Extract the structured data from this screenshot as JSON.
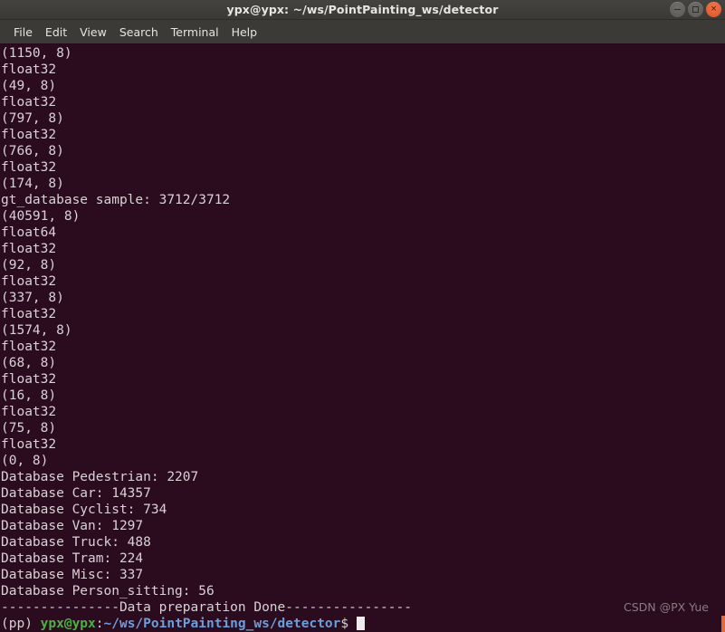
{
  "window": {
    "title": "ypx@ypx: ~/ws/PointPainting_ws/detector",
    "controls": {
      "minimize": "minimize-button",
      "maximize": "maximize-button",
      "close": "close-button",
      "close_glyph": "×"
    },
    "colors": {
      "titlebar_bg": "#3f3e3a",
      "menubar_bg": "#3b3a36",
      "terminal_bg": "#2b0c1e",
      "terminal_fg": "#d8d2d6",
      "prompt_user": "#4ab243",
      "prompt_path": "#6a9fdd",
      "close_button": "#e0562c",
      "scroll_thumb": "#e06a3c"
    }
  },
  "menubar": {
    "items": [
      {
        "label": "File"
      },
      {
        "label": "Edit"
      },
      {
        "label": "View"
      },
      {
        "label": "Search"
      },
      {
        "label": "Terminal"
      },
      {
        "label": "Help"
      }
    ]
  },
  "terminal": {
    "lines": [
      "(1150, 8)",
      "float32",
      "(49, 8)",
      "float32",
      "(797, 8)",
      "float32",
      "(766, 8)",
      "float32",
      "(174, 8)",
      "gt_database sample: 3712/3712",
      "(40591, 8)",
      "float64",
      "float32",
      "(92, 8)",
      "float32",
      "(337, 8)",
      "float32",
      "(1574, 8)",
      "float32",
      "(68, 8)",
      "float32",
      "(16, 8)",
      "float32",
      "(75, 8)",
      "float32",
      "(0, 8)",
      "Database Pedestrian: 2207",
      "Database Car: 14357",
      "Database Cyclist: 734",
      "Database Van: 1297",
      "Database Truck: 488",
      "Database Tram: 224",
      "Database Misc: 337",
      "Database Person_sitting: 56",
      "---------------Data preparation Done----------------"
    ],
    "prompt": {
      "env": "(pp) ",
      "user_host": "ypx@ypx",
      "colon": ":",
      "path": "~/ws/PointPainting_ws/detector",
      "sigil": "$ "
    }
  },
  "watermark": {
    "text": "CSDN @PX Yue"
  }
}
